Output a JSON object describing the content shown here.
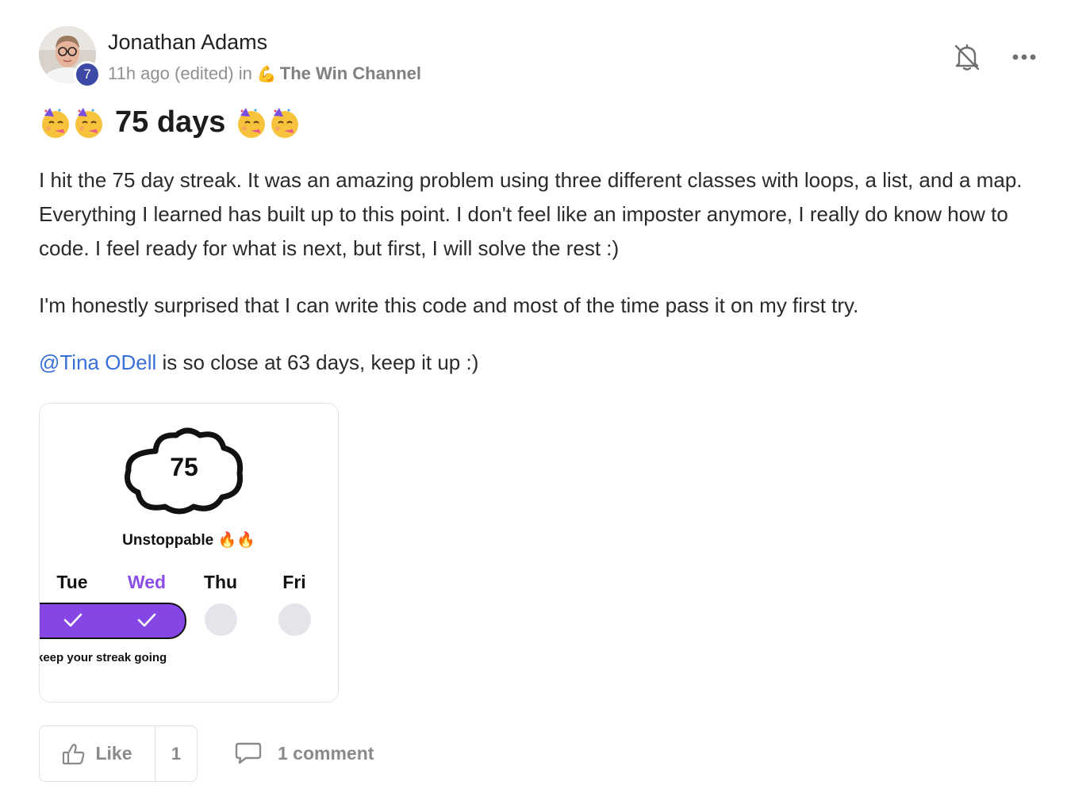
{
  "author": {
    "name": "Jonathan Adams",
    "level": "7",
    "avatar_icon": "user-avatar-photo"
  },
  "meta": {
    "time": "11h ago",
    "edited": "(edited)",
    "in_word": "in",
    "channel_emoji": "💪",
    "channel": "The Win Channel"
  },
  "header_actions": {
    "bell_icon": "bell-off-icon",
    "more_icon": "more-horizontal-icon"
  },
  "post": {
    "title": "75 days",
    "title_emoji": "partying-face-emoji",
    "paragraphs": [
      "I hit the 75 day streak. It was an amazing problem using three different classes with loops, a list, and a map. Everything I learned has built up to this point. I don't feel like an imposter anymore, I really do know how to code. I feel ready for what is next, but first, I will solve the rest :)",
      "I'm honestly surprised that I can write this code and most of the time pass it on my first try."
    ],
    "mention": "@Tina ODell",
    "mention_rest": " is so close at 63 days, keep it up :)"
  },
  "streak_card": {
    "number": "75",
    "label": "Unstoppable 🔥🔥",
    "days": [
      "Tue",
      "Wed",
      "Thu",
      "Fri"
    ],
    "completed_days": [
      "Tue",
      "Wed"
    ],
    "active_day": "Wed",
    "footer": "keep your streak going",
    "accent": "#8646e6"
  },
  "actions": {
    "like_label": "Like",
    "like_count": "1",
    "comment_label": "1 comment"
  },
  "colors": {
    "mention": "#3b6fd8",
    "badge": "#3d4aa5",
    "muted": "#8a8a8a"
  }
}
